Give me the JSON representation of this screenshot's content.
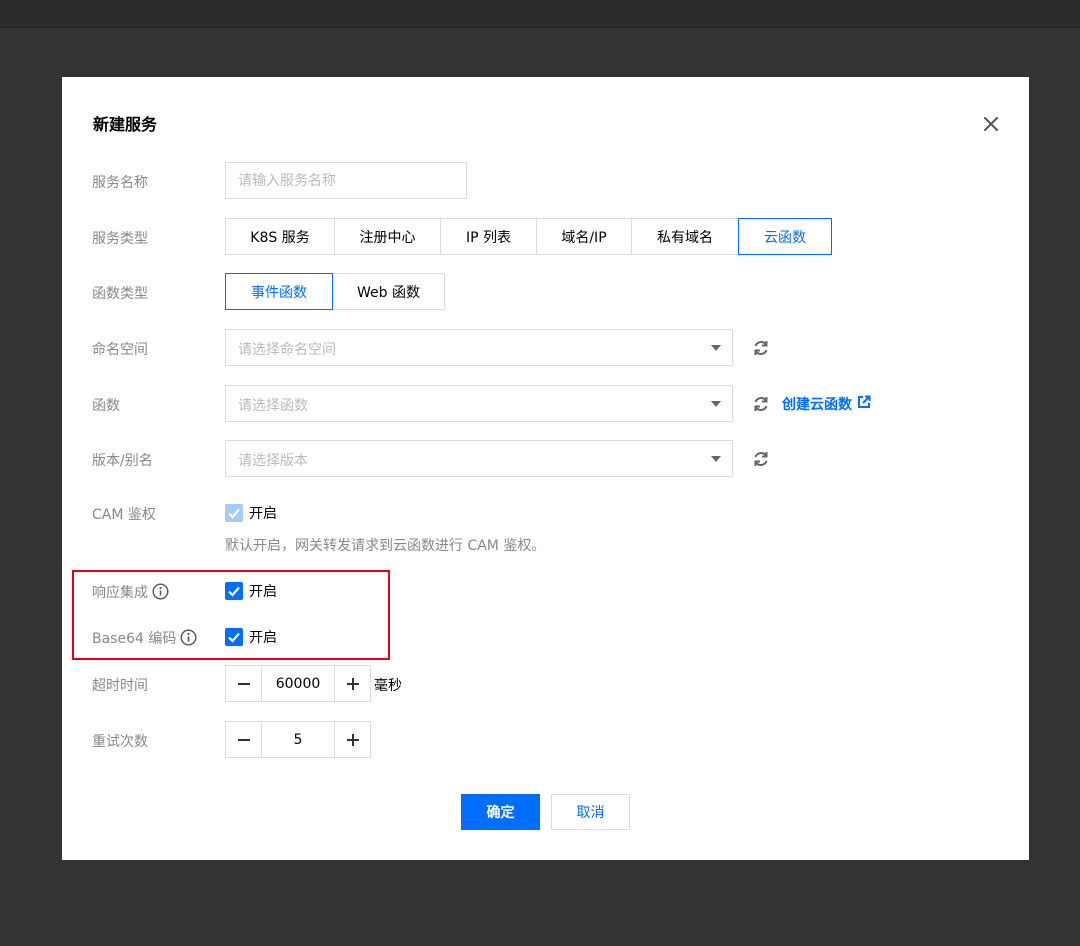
{
  "dialog": {
    "title": "新建服务"
  },
  "service_name": {
    "label": "服务名称",
    "placeholder": "请输入服务名称",
    "value": ""
  },
  "service_type": {
    "label": "服务类型",
    "options": [
      "K8S 服务",
      "注册中心",
      "IP 列表",
      "域名/IP",
      "私有域名",
      "云函数"
    ],
    "selected": "云函数"
  },
  "function_type": {
    "label": "函数类型",
    "options": [
      "事件函数",
      "Web 函数"
    ],
    "selected": "事件函数"
  },
  "namespace": {
    "label": "命名空间",
    "placeholder": "请选择命名空间"
  },
  "function": {
    "label": "函数",
    "placeholder": "请选择函数",
    "create_link": "创建云函数"
  },
  "version": {
    "label": "版本/别名",
    "placeholder": "请选择版本"
  },
  "cam_auth": {
    "label": "CAM 鉴权",
    "checkbox_label": "开启",
    "checked": true,
    "disabled": true,
    "hint": "默认开启，网关转发请求到云函数进行 CAM 鉴权。"
  },
  "response_integration": {
    "label": "响应集成",
    "checkbox_label": "开启",
    "checked": true
  },
  "base64": {
    "label": "Base64 编码",
    "checkbox_label": "开启",
    "checked": true
  },
  "timeout": {
    "label": "超时时间",
    "value": "60000",
    "unit": "毫秒"
  },
  "retries": {
    "label": "重试次数",
    "value": "5"
  },
  "footer": {
    "confirm_label": "确定",
    "cancel_label": "取消"
  },
  "colors": {
    "accent": "#006eff",
    "highlight_border": "#e0001f",
    "overlay": "#333333"
  },
  "icons": [
    "close-icon",
    "refresh-icon",
    "external-link-icon",
    "info-icon",
    "check-icon",
    "chevron-down-icon",
    "minus-icon",
    "plus-icon"
  ]
}
